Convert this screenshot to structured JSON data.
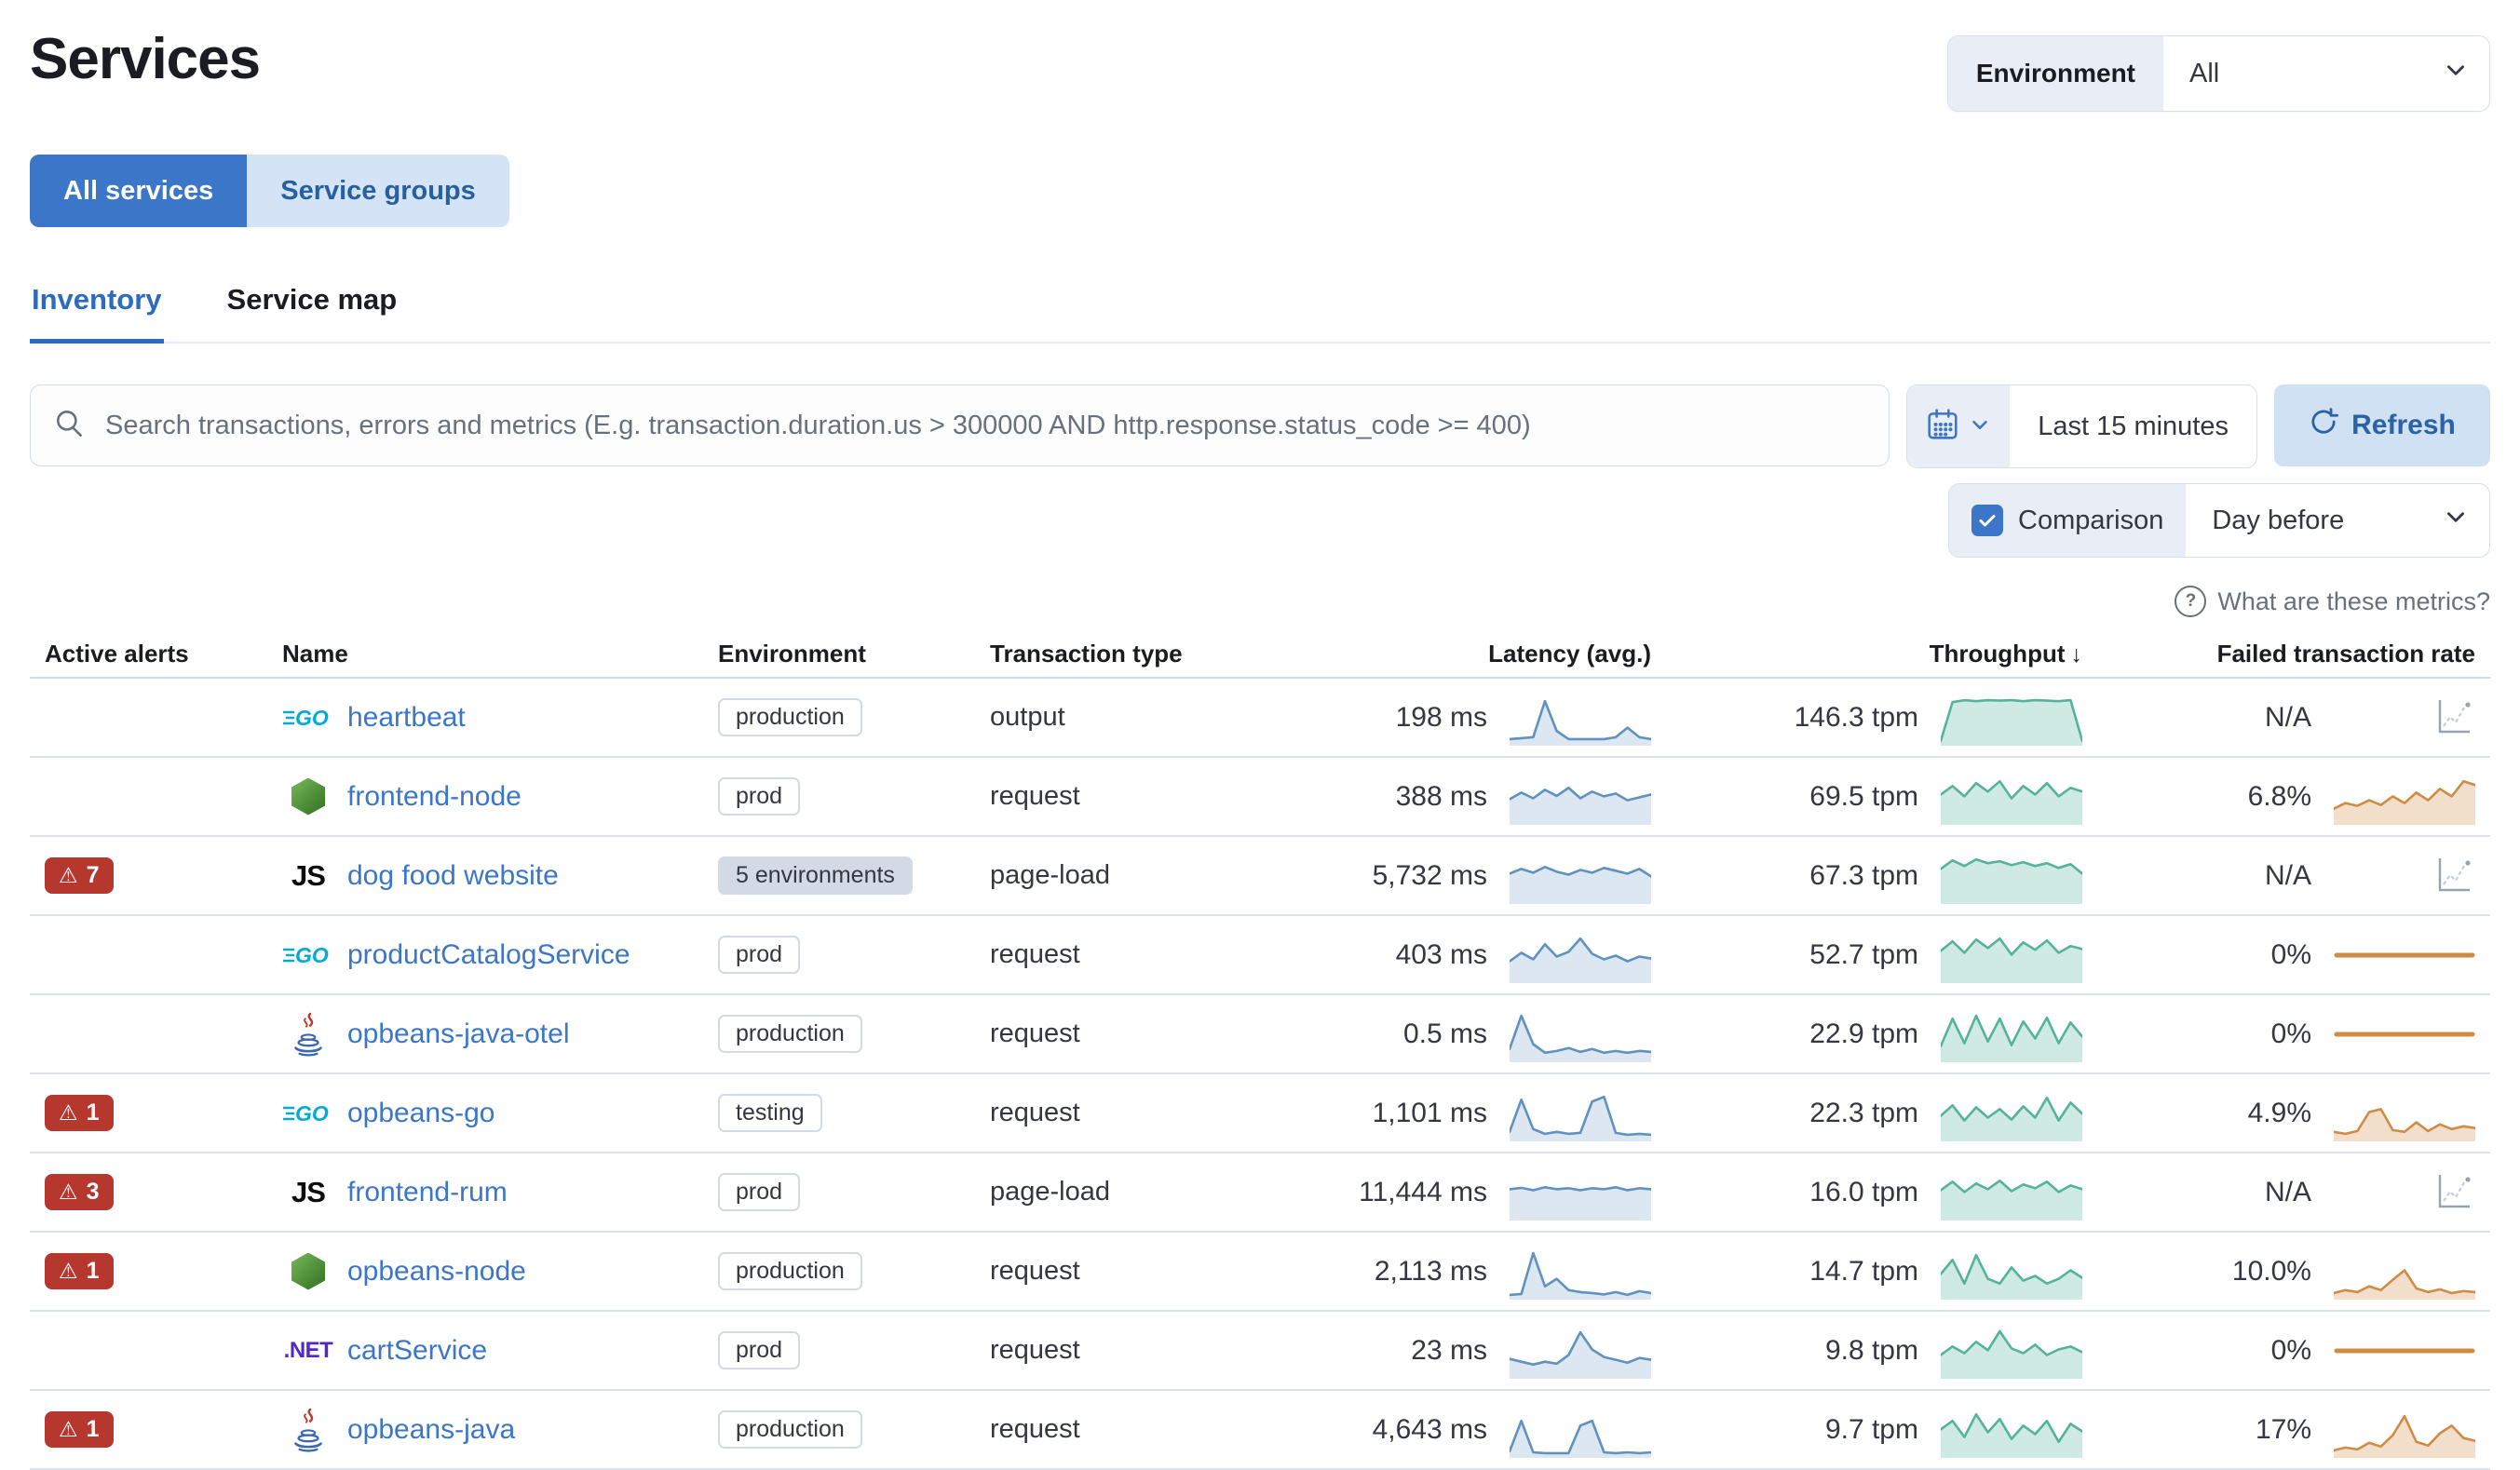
{
  "page": {
    "title": "Services"
  },
  "env_filter": {
    "label": "Environment",
    "value": "All"
  },
  "view_toggle": {
    "all_services": "All services",
    "service_groups": "Service groups"
  },
  "tabs": {
    "inventory": "Inventory",
    "service_map": "Service map"
  },
  "search": {
    "placeholder": "Search transactions, errors and metrics (E.g. transaction.duration.us > 300000 AND http.response.status_code >= 400)"
  },
  "time_controls": {
    "range_label": "Last 15 minutes",
    "refresh_label": "Refresh"
  },
  "comparison": {
    "label": "Comparison",
    "checked": true,
    "value": "Day before"
  },
  "help_link": {
    "label": "What are these metrics?"
  },
  "colors": {
    "accent_blue": "#3b76c8",
    "light_blue_bg": "#d4e4f6",
    "lavender_bg": "#e9edf6",
    "danger_red": "#b5372e",
    "latency_blue": "#6092C0",
    "latency_fill": "rgba(96,146,192,0.22)",
    "throughput_green": "#54B399",
    "throughput_fill": "rgba(84,179,153,0.28)",
    "failed_orange": "#d08b44",
    "failed_fill": "rgba(208,139,68,0.28)",
    "border": "#d3dae6"
  },
  "table": {
    "columns": [
      "Active alerts",
      "Name",
      "Environment",
      "Transaction type",
      "Latency (avg.)",
      "Throughput",
      "Failed transaction rate"
    ],
    "sort_indicator": "↓",
    "alert_icon_glyph": "⚠",
    "rows": [
      {
        "alerts": null,
        "agent_icon": "go",
        "name": "heartbeat",
        "environment": "production",
        "env_badge_style": "outline",
        "transaction_type": "output",
        "latency": "198 ms",
        "latency_spark": [
          8,
          10,
          12,
          88,
          25,
          8,
          8,
          8,
          8,
          12,
          32,
          12,
          8
        ],
        "throughput": "146.3 tpm",
        "throughput_spark": [
          4,
          86,
          90,
          88,
          90,
          89,
          90,
          88,
          90,
          89,
          88,
          90,
          4
        ],
        "failed_rate": "N/A",
        "failed_spark": null
      },
      {
        "alerts": null,
        "agent_icon": "node",
        "name": "frontend-node",
        "environment": "prod",
        "env_badge_style": "outline",
        "transaction_type": "request",
        "latency": "388 ms",
        "latency_spark": [
          48,
          62,
          50,
          68,
          55,
          72,
          50,
          64,
          54,
          60,
          46,
          52,
          58
        ],
        "throughput": "69.5 tpm",
        "throughput_spark": [
          58,
          76,
          54,
          82,
          64,
          86,
          50,
          76,
          58,
          82,
          54,
          72,
          64
        ],
        "failed_rate": "6.8%",
        "failed_spark": [
          28,
          40,
          34,
          46,
          36,
          54,
          40,
          62,
          46,
          70,
          54,
          86,
          78
        ]
      },
      {
        "alerts": "7",
        "agent_icon": "js",
        "name": "dog food website",
        "environment": "5 environments",
        "env_badge_style": "filled",
        "transaction_type": "page-load",
        "latency": "5,732 ms",
        "latency_spark": [
          58,
          68,
          60,
          72,
          62,
          56,
          66,
          60,
          70,
          64,
          58,
          68,
          52
        ],
        "throughput": "67.3 tpm",
        "throughput_spark": [
          68,
          86,
          74,
          88,
          80,
          84,
          76,
          82,
          74,
          80,
          70,
          78,
          58
        ],
        "failed_rate": "N/A",
        "failed_spark": null
      },
      {
        "alerts": null,
        "agent_icon": "go",
        "name": "productCatalogService",
        "environment": "prod",
        "env_badge_style": "outline",
        "transaction_type": "request",
        "latency": "403 ms",
        "latency_spark": [
          40,
          58,
          44,
          76,
          50,
          60,
          88,
          56,
          44,
          52,
          40,
          50,
          46
        ],
        "throughput": "52.7 tpm",
        "throughput_spark": [
          62,
          82,
          58,
          86,
          68,
          88,
          54,
          80,
          64,
          84,
          58,
          72,
          66
        ],
        "failed_rate": "0%",
        "failed_spark": "flat"
      },
      {
        "alerts": null,
        "agent_icon": "java",
        "name": "opbeans-java-otel",
        "environment": "production",
        "env_badge_style": "outline",
        "transaction_type": "request",
        "latency": "0.5 ms",
        "latency_spark": [
          22,
          92,
          32,
          14,
          18,
          24,
          16,
          22,
          14,
          18,
          14,
          18,
          16
        ],
        "throughput": "22.9 tpm",
        "throughput_spark": [
          28,
          86,
          34,
          92,
          38,
          86,
          30,
          80,
          44,
          88,
          34,
          78,
          48
        ],
        "failed_rate": "0%",
        "failed_spark": "flat"
      },
      {
        "alerts": "1",
        "agent_icon": "go",
        "name": "opbeans-go",
        "environment": "testing",
        "env_badge_style": "outline",
        "transaction_type": "request",
        "latency": "1,101 ms",
        "latency_spark": [
          14,
          82,
          20,
          10,
          14,
          10,
          12,
          78,
          88,
          12,
          8,
          10,
          8
        ],
        "throughput": "22.3 tpm",
        "throughput_spark": [
          48,
          70,
          38,
          66,
          44,
          62,
          40,
          68,
          44,
          86,
          38,
          76,
          52
        ],
        "failed_rate": "4.9%",
        "failed_spark": [
          14,
          10,
          16,
          56,
          62,
          18,
          14,
          34,
          16,
          30,
          20,
          26,
          22
        ]
      },
      {
        "alerts": "3",
        "agent_icon": "js",
        "name": "frontend-rum",
        "environment": "prod",
        "env_badge_style": "outline",
        "transaction_type": "page-load",
        "latency": "11,444 ms",
        "latency_spark": [
          60,
          63,
          58,
          64,
          60,
          62,
          58,
          62,
          60,
          64,
          58,
          62,
          60
        ],
        "throughput": "16.0 tpm",
        "throughput_spark": [
          58,
          76,
          54,
          72,
          60,
          78,
          56,
          70,
          62,
          76,
          54,
          68,
          60
        ],
        "failed_rate": "N/A",
        "failed_spark": null
      },
      {
        "alerts": "1",
        "agent_icon": "node",
        "name": "opbeans-node",
        "environment": "production",
        "env_badge_style": "outline",
        "transaction_type": "request",
        "latency": "2,113 ms",
        "latency_spark": [
          4,
          6,
          92,
          22,
          38,
          14,
          10,
          8,
          5,
          10,
          4,
          12,
          8
        ],
        "throughput": "14.7 tpm",
        "throughput_spark": [
          48,
          78,
          28,
          88,
          38,
          28,
          62,
          34,
          44,
          28,
          38,
          56,
          40
        ],
        "failed_rate": "10.0%",
        "failed_spark": [
          8,
          14,
          10,
          22,
          14,
          36,
          56,
          18,
          10,
          16,
          8,
          12,
          10
        ]
      },
      {
        "alerts": null,
        "agent_icon": "dotnet",
        "name": "cartService",
        "environment": "prod",
        "env_badge_style": "outline",
        "transaction_type": "request",
        "latency": "23 ms",
        "latency_spark": [
          36,
          30,
          24,
          30,
          26,
          44,
          92,
          56,
          40,
          34,
          28,
          38,
          34
        ],
        "throughput": "9.8 tpm",
        "throughput_spark": [
          44,
          62,
          48,
          72,
          54,
          94,
          58,
          48,
          66,
          44,
          56,
          62,
          50
        ],
        "failed_rate": "0%",
        "failed_spark": "flat"
      },
      {
        "alerts": "1",
        "agent_icon": "java",
        "name": "opbeans-java",
        "environment": "production",
        "env_badge_style": "outline",
        "transaction_type": "request",
        "latency": "4,643 ms",
        "latency_spark": [
          8,
          72,
          6,
          4,
          4,
          4,
          62,
          72,
          6,
          4,
          6,
          4,
          6
        ],
        "throughput": "9.7 tpm",
        "throughput_spark": [
          54,
          72,
          38,
          86,
          48,
          76,
          34,
          62,
          44,
          72,
          28,
          66,
          50
        ],
        "failed_rate": "17%",
        "failed_spark": [
          10,
          16,
          12,
          26,
          18,
          42,
          82,
          28,
          20,
          46,
          62,
          36,
          30
        ]
      }
    ]
  }
}
